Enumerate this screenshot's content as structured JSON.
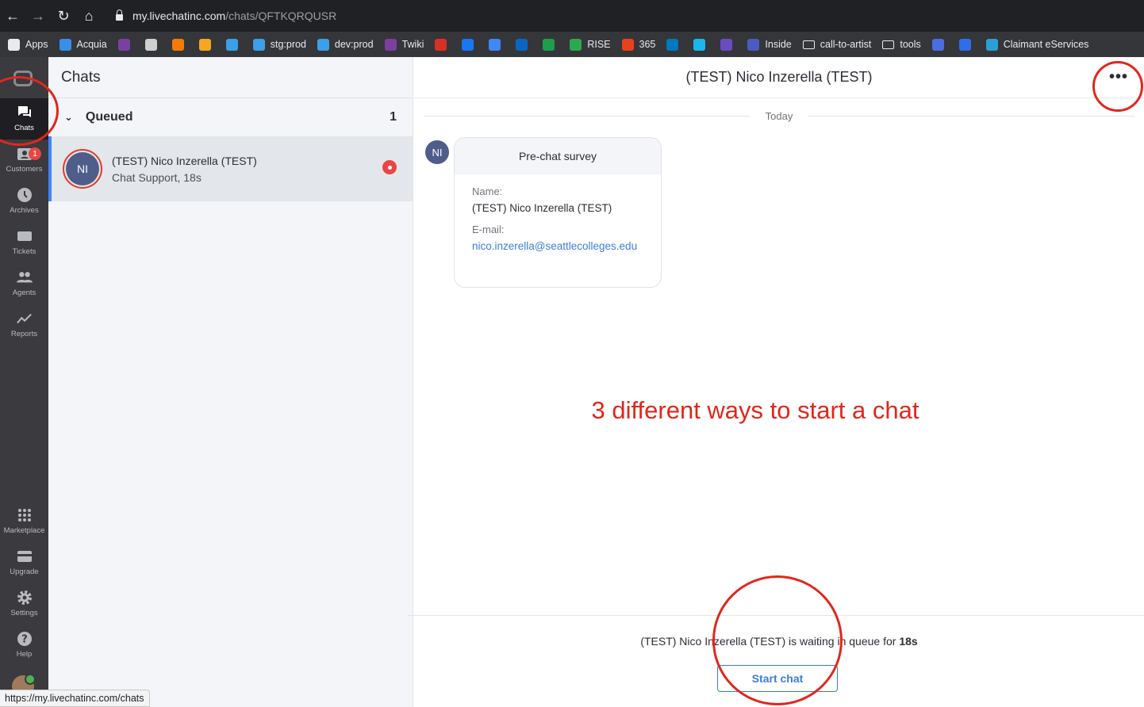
{
  "browser": {
    "url_host": "my.livechatinc.com",
    "url_path": "/chats/QFTKQRQUSR",
    "bookmarks": [
      {
        "label": "Apps",
        "color": "#e8eaed"
      },
      {
        "label": "Acquia",
        "color": "#3b8ee8"
      },
      {
        "label": "",
        "color": "#7b3fa0"
      },
      {
        "label": "",
        "color": "#cfcfcf"
      },
      {
        "label": "",
        "color": "#f57c00"
      },
      {
        "label": "",
        "color": "#f5a623"
      },
      {
        "label": "",
        "color": "#3ba0e8"
      },
      {
        "label": "stg:prod",
        "color": "#3ba0e8"
      },
      {
        "label": "dev:prod",
        "color": "#3ba0e8"
      },
      {
        "label": "Twiki",
        "color": "#7b3fa0"
      },
      {
        "label": "",
        "color": "#d93025"
      },
      {
        "label": "",
        "color": "#1877f2"
      },
      {
        "label": "",
        "color": "#4285f4"
      },
      {
        "label": "",
        "color": "#0a66c2"
      },
      {
        "label": "",
        "color": "#1e9e4a"
      },
      {
        "label": "RISE",
        "color": "#2ea84f"
      },
      {
        "label": "365",
        "color": "#e8411c"
      },
      {
        "label": "",
        "color": "#0079bf"
      },
      {
        "label": "",
        "color": "#1ab7ea"
      },
      {
        "label": "",
        "color": "#6b4cbf"
      },
      {
        "label": "Inside",
        "color": "#4a5cbf"
      }
    ],
    "bookmark_folders": [
      "call-to-artist",
      "tools"
    ],
    "bookmarks_tail": [
      {
        "label": "",
        "color": "#4a6ee0"
      },
      {
        "label": "",
        "color": "#2f6ee8"
      },
      {
        "label": "Claimant eServices",
        "color": "#2a9fd6"
      }
    ],
    "status_url": "https://my.livechatinc.com/chats"
  },
  "rail": {
    "items": [
      {
        "label": "Chats",
        "icon": "chat-bubbles-icon"
      },
      {
        "label": "Customers",
        "icon": "customers-icon",
        "badge": "1"
      },
      {
        "label": "Archives",
        "icon": "clock-icon"
      },
      {
        "label": "Tickets",
        "icon": "ticket-icon"
      },
      {
        "label": "Agents",
        "icon": "agents-icon"
      },
      {
        "label": "Reports",
        "icon": "chart-line-icon"
      },
      {
        "label": "Marketplace",
        "icon": "grid-icon"
      },
      {
        "label": "Upgrade",
        "icon": "card-icon"
      },
      {
        "label": "Settings",
        "icon": "gear-icon"
      },
      {
        "label": "Help",
        "icon": "help-icon"
      }
    ]
  },
  "list": {
    "title": "Chats",
    "section": {
      "label": "Queued",
      "count": "1"
    },
    "chat": {
      "initials": "NI",
      "name": "(TEST) Nico Inzerella (TEST)",
      "sub": "Chat Support, 18s"
    }
  },
  "main": {
    "title": "(TEST) Nico Inzerella (TEST)",
    "more": "•••",
    "day_divider": "Today",
    "avatar_initials": "NI",
    "survey": {
      "title": "Pre-chat survey",
      "name_label": "Name:",
      "name_value": "(TEST) Nico Inzerella (TEST)",
      "email_label": "E-mail:",
      "email_value": "nico.inzerella@seattlecolleges.edu"
    },
    "annotation": "3 different ways to start a chat",
    "waiting_prefix": "(TEST) Nico Inzerella (TEST) is waiting in queue for ",
    "waiting_time": "18s",
    "start_button": "Start chat"
  },
  "colors": {
    "accent": "#4384f5",
    "annotation_red": "#e2261b",
    "badge_red": "#e84545",
    "rail_bg": "#3a3a3f"
  }
}
